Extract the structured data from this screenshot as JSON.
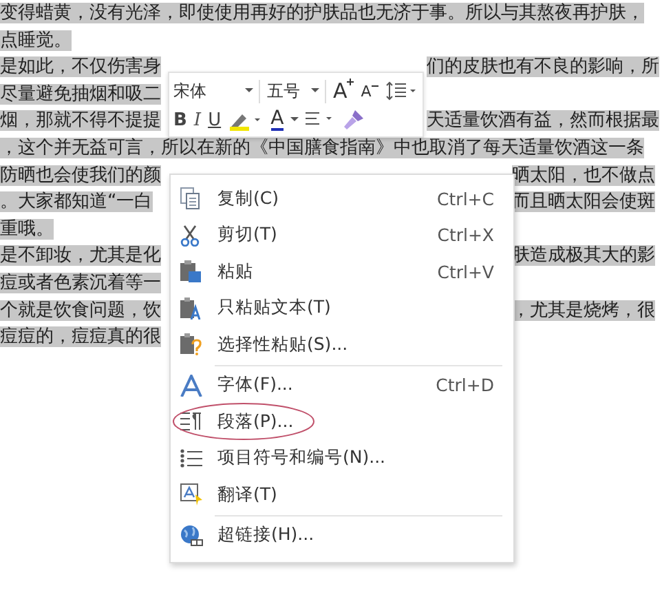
{
  "document": {
    "lines": [
      {
        "kind": "full",
        "left": "变得蜡黄，没有光泽，即使使用再好的护肤品也无济于事。所以与其熬夜再护肤，"
      },
      {
        "kind": "full",
        "left": "点睡觉。"
      },
      {
        "kind": "toolbar",
        "left": "是如此，不仅伤害身",
        "right": "们的皮肤也有不良的影响，所"
      },
      {
        "kind": "toolbar",
        "left": "尽量避免抽烟和吸二"
      },
      {
        "kind": "toolbar",
        "left": "烟，那就不得不提提",
        "right": "天适量饮酒有益，然而根据最"
      },
      {
        "kind": "full",
        "left": "，这个并无益可言，所以在新的《中国膳食指南》中也取消了每天适量饮酒这一条"
      },
      {
        "kind": "menu",
        "left": "防晒也会使我们的颜",
        "right": "晒太阳，也不做点"
      },
      {
        "kind": "menu",
        "left": "。大家都知道“一白",
        "right": "而且晒太阳会使斑"
      },
      {
        "kind": "menu",
        "left": "重哦。"
      },
      {
        "kind": "menu",
        "left": "是不卸妆，尤其是化",
        "right": "肤造成极其大的影"
      },
      {
        "kind": "menu",
        "left": "痘或者色素沉着等一"
      },
      {
        "kind": "menu",
        "left": "个就是饮食问题，饮",
        "right": "，尤其是烧烤，很"
      },
      {
        "kind": "menu",
        "left": "痘痘的，痘痘真的很"
      }
    ]
  },
  "mini_toolbar": {
    "font": "宋体",
    "size": "五号",
    "grow_font": "A",
    "shrink_font": "A",
    "bold": "B",
    "italic": "I",
    "underline": "U",
    "font_color": "A"
  },
  "context_menu": {
    "items": [
      {
        "label": "复制(C)",
        "shortcut": "Ctrl+C",
        "separator_before": false,
        "circled": false
      },
      {
        "label": "剪切(T)",
        "shortcut": "Ctrl+X",
        "separator_before": false,
        "circled": false
      },
      {
        "label": "粘贴",
        "shortcut": "Ctrl+V",
        "separator_before": false,
        "circled": false
      },
      {
        "label": "只粘贴文本(T)",
        "separator_before": false,
        "circled": false
      },
      {
        "label": "选择性粘贴(S)...",
        "separator_before": false,
        "circled": false
      },
      {
        "label": "字体(F)...",
        "shortcut": "Ctrl+D",
        "separator_before": true,
        "circled": false
      },
      {
        "label": "段落(P)...",
        "separator_before": false,
        "circled": true
      },
      {
        "label": "项目符号和编号(N)...",
        "separator_before": false,
        "circled": false
      },
      {
        "label": "翻译(T)",
        "separator_before": false,
        "circled": false
      },
      {
        "label": "超链接(H)...",
        "separator_before": true,
        "circled": false
      }
    ]
  }
}
